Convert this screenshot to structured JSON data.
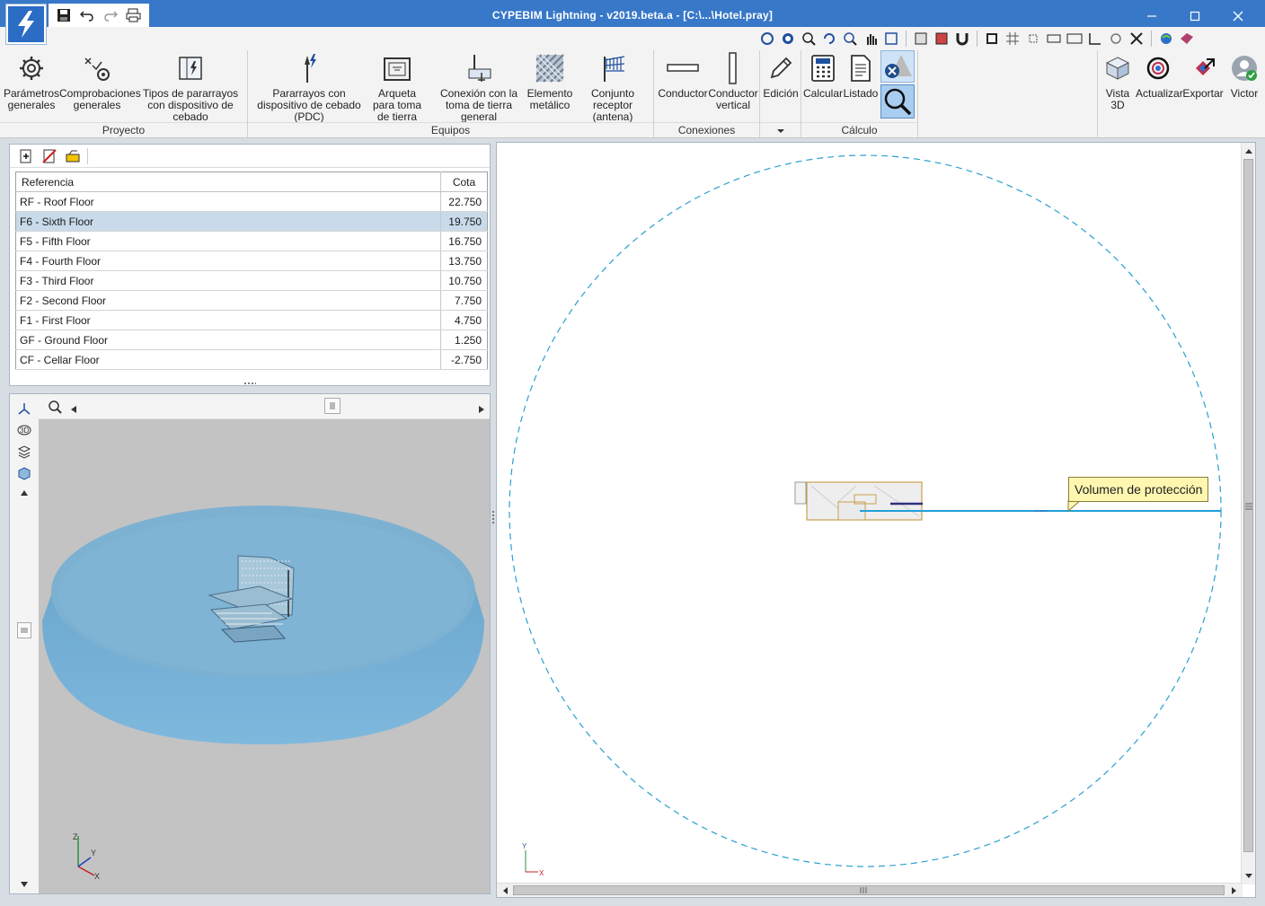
{
  "window": {
    "title": "CYPEBIM Lightning - v2019.beta.a - [C:\\...\\Hotel.pray]"
  },
  "ribbon": {
    "groups": {
      "proyecto": "Proyecto",
      "equipos": "Equipos",
      "conexiones": "Conexiones",
      "calculo": "Cálculo"
    },
    "buttons": {
      "parametros": "Parámetros generales",
      "comprobaciones": "Comprobaciones generales",
      "tipos": "Tipos de pararrayos con dispositivo de cebado",
      "pararrayos_pdc": "Pararrayos con dispositivo de cebado (PDC)",
      "arqueta": "Arqueta para toma de tierra",
      "conexion": "Conexión con la toma de tierra general",
      "elemento": "Elemento metálico",
      "conjunto": "Conjunto receptor (antena)",
      "conductor": "Conductor",
      "conductor_vertical": "Conductor vertical",
      "edicion": "Edición",
      "calcular": "Calcular",
      "listado": "Listado",
      "vista3d": "Vista 3D",
      "actualizar": "Actualizar",
      "exportar": "Exportar",
      "victor": "Victor"
    }
  },
  "floors": {
    "columns": {
      "ref": "Referencia",
      "cota": "Cota"
    },
    "selected_index": 1,
    "rows": [
      {
        "ref": "RF - Roof Floor",
        "cota": "22.750"
      },
      {
        "ref": "F6 - Sixth Floor",
        "cota": "19.750"
      },
      {
        "ref": "F5 - Fifth Floor",
        "cota": "16.750"
      },
      {
        "ref": "F4 - Fourth Floor",
        "cota": "13.750"
      },
      {
        "ref": "F3 - Third Floor",
        "cota": "10.750"
      },
      {
        "ref": "F2 - Second Floor",
        "cota": "7.750"
      },
      {
        "ref": "F1 - First Floor",
        "cota": "4.750"
      },
      {
        "ref": "GF - Ground Floor",
        "cota": "1.250"
      },
      {
        "ref": "CF - Cellar Floor",
        "cota": "-2.750"
      }
    ]
  },
  "plan": {
    "tooltip": "Volumen de protección",
    "axis_x": "X",
    "axis_y": "Y"
  },
  "view3d": {
    "axis_x": "X",
    "axis_y": "Y",
    "axis_z": "Z"
  },
  "colors": {
    "titlebar": "#3878c8",
    "protection_volume": "#7fb4d6",
    "dashed_circle": "#2aa0d0",
    "selected_row": "#c9dbeb"
  }
}
